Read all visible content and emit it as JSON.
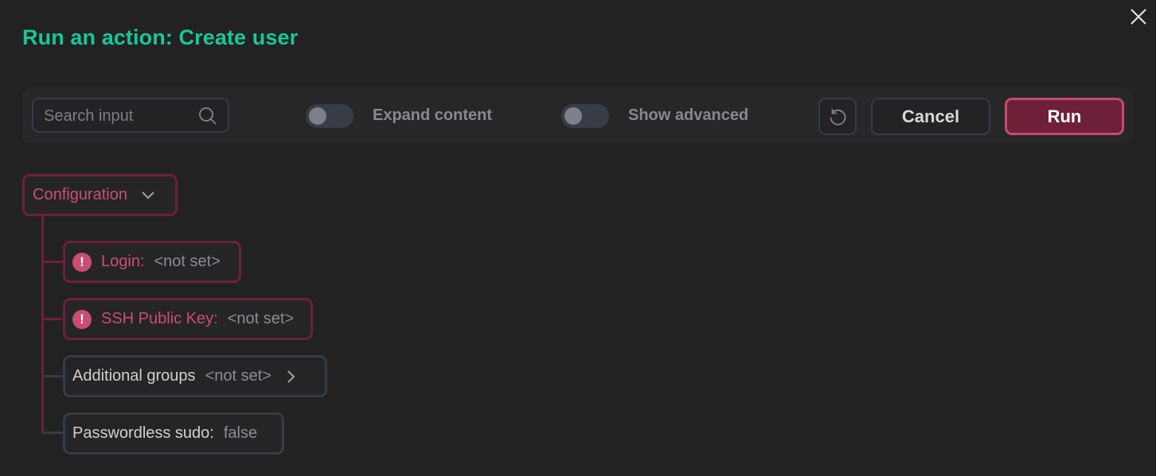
{
  "dialog": {
    "title": "Run an action: Create user",
    "close_icon": "close-icon"
  },
  "toolbar": {
    "search_placeholder": "Search input",
    "search_value": "",
    "expand_content_label": "Expand content",
    "expand_content_on": false,
    "show_advanced_label": "Show advanced",
    "show_advanced_on": false,
    "reset_icon": "reset-icon",
    "cancel_label": "Cancel",
    "run_label": "Run"
  },
  "tree": {
    "group_label": "Configuration",
    "group_expanded": true,
    "fields": [
      {
        "label": "Login:",
        "value": "<not set>",
        "error": true
      },
      {
        "label": "SSH Public Key:",
        "value": "<not set>",
        "error": true
      },
      {
        "label": "Additional groups",
        "value": "<not set>",
        "error": false,
        "expandable": true
      },
      {
        "label": "Passwordless sudo:",
        "value": "false",
        "error": false
      }
    ]
  },
  "colors": {
    "title": "#17c79a",
    "accent_error": "#cc4d73",
    "run_bg": "#6e2038",
    "border_neutral": "#343c47",
    "background": "#222223"
  }
}
